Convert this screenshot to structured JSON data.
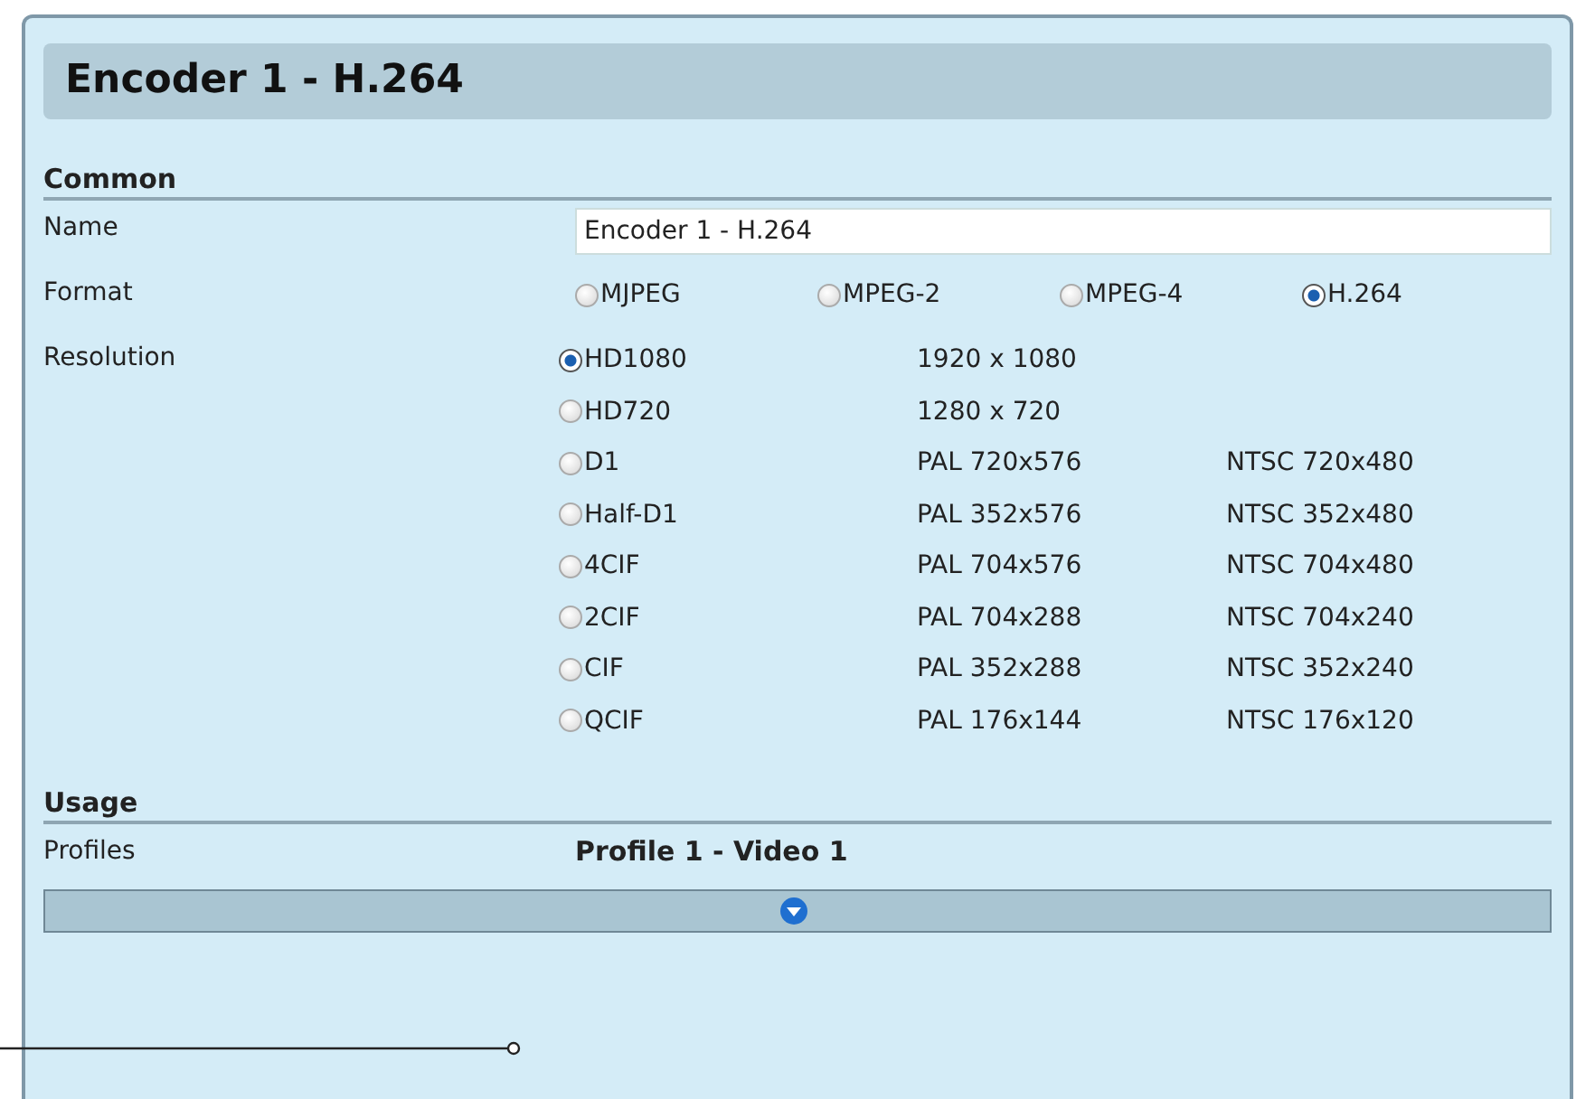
{
  "panel": {
    "title": "Encoder 1 - H.264"
  },
  "common": {
    "heading": "Common",
    "name": {
      "label": "Name",
      "value": "Encoder 1 - H.264"
    },
    "format": {
      "label": "Format",
      "options": [
        {
          "label": "MJPEG",
          "selected": false
        },
        {
          "label": "MPEG-2",
          "selected": false
        },
        {
          "label": "MPEG-4",
          "selected": false
        },
        {
          "label": "H.264",
          "selected": true
        }
      ]
    },
    "resolution": {
      "label": "Resolution",
      "options": [
        {
          "label": "HD1080",
          "selected": true,
          "size": "1920 x 1080"
        },
        {
          "label": "HD720",
          "selected": false,
          "size": "1280 x 720"
        },
        {
          "label": "D1",
          "selected": false,
          "pal": "PAL 720x576",
          "ntsc": "NTSC 720x480"
        },
        {
          "label": "Half-D1",
          "selected": false,
          "pal": "PAL 352x576",
          "ntsc": "NTSC 352x480"
        },
        {
          "label": "4CIF",
          "selected": false,
          "pal": "PAL 704x576",
          "ntsc": "NTSC 704x480"
        },
        {
          "label": "2CIF",
          "selected": false,
          "pal": "PAL 704x288",
          "ntsc": "NTSC 704x240"
        },
        {
          "label": "CIF",
          "selected": false,
          "pal": "PAL 352x288",
          "ntsc": "NTSC 352x240"
        },
        {
          "label": "QCIF",
          "selected": false,
          "pal": "PAL 176x144",
          "ntsc": "NTSC 176x120"
        }
      ]
    }
  },
  "usage": {
    "heading": "Usage",
    "profiles": {
      "label": "Profiles",
      "value": "Profile 1 - Video 1"
    }
  }
}
